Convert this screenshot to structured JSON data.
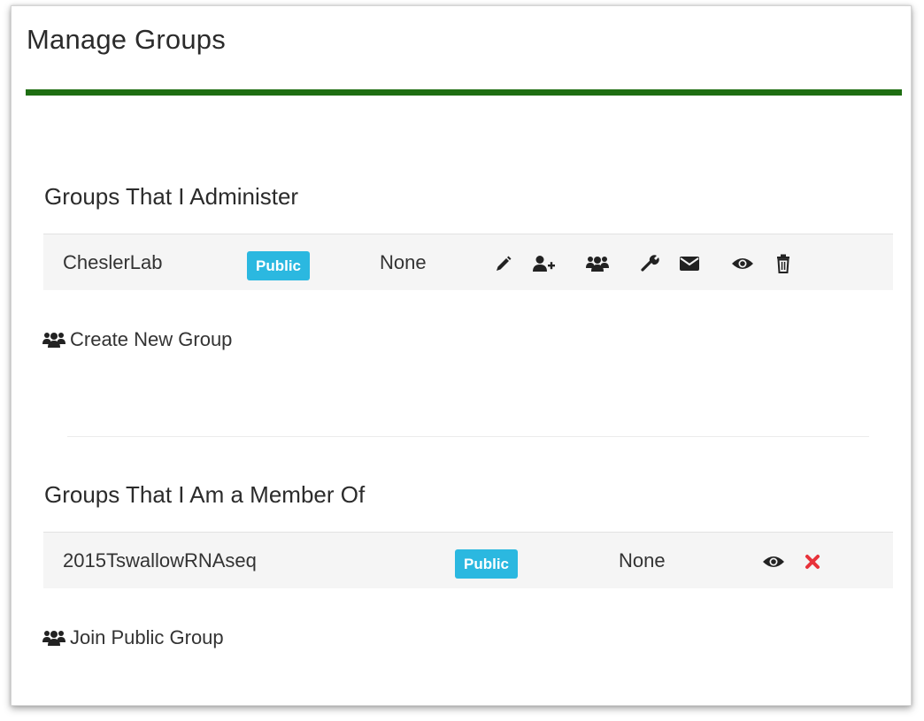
{
  "page": {
    "title": "Manage Groups"
  },
  "colors": {
    "accent_rule": "#1e6e12",
    "badge": "#2bb8e0",
    "remove": "#e8323a"
  },
  "administer": {
    "heading": "Groups That I Administer",
    "rows": [
      {
        "name": "CheslerLab",
        "visibility": "Public",
        "status": "None",
        "actions": [
          "pencil-icon",
          "add-user-icon",
          "users-icon",
          "wrench-icon",
          "envelope-icon",
          "eye-icon",
          "trash-icon"
        ]
      }
    ],
    "create_label": "Create New Group"
  },
  "member": {
    "heading": "Groups That I Am a Member Of",
    "rows": [
      {
        "name": "2015TswallowRNAseq",
        "visibility": "Public",
        "status": "None",
        "actions": [
          "eye-icon",
          "remove-icon"
        ]
      }
    ],
    "join_label": "Join Public Group"
  }
}
